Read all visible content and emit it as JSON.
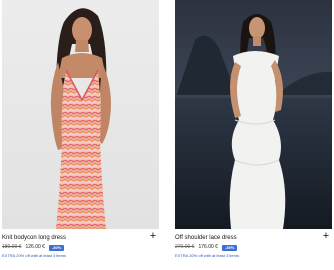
{
  "products": [
    {
      "name": "Knit bodycon long dress",
      "old_price": "180.00 €",
      "new_price": "126.00 €",
      "discount": "-30%",
      "promo": "EXTRA 20% off with at least 3 items",
      "add_icon": "plus-icon"
    },
    {
      "name": "Off shoulder lace dress",
      "old_price": "270.00 €",
      "new_price": "176.00 €",
      "discount": "-35%",
      "promo": "EXTRA 20% off with at least 3 items",
      "add_icon": "plus-icon"
    }
  ]
}
